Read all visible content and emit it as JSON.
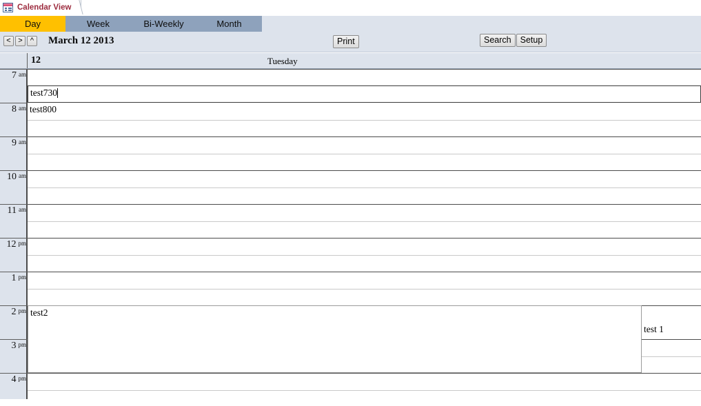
{
  "window": {
    "doc_tab": {
      "label": "Calendar View",
      "icon": "form-datasheet-icon"
    }
  },
  "view_tabs": [
    {
      "label": "Day",
      "active": true
    },
    {
      "label": "Week",
      "active": false
    },
    {
      "label": "Bi-Weekly",
      "active": false
    },
    {
      "label": "Month",
      "active": false
    }
  ],
  "toolbar": {
    "search_label": "Search",
    "setup_label": "Setup",
    "print_label": "Print",
    "prev_label": "<",
    "next_label": ">",
    "up_label": "^",
    "active_tab_color": "#ffc000",
    "tabbar_color": "#8ea2bc",
    "toolbar_color": "#dde3ec"
  },
  "date_nav": {
    "title": "March 12 2013"
  },
  "day_header": {
    "day_number": "12",
    "day_name": "Tuesday"
  },
  "hours": [
    {
      "hour": "7",
      "meridiem": "am"
    },
    {
      "hour": "8",
      "meridiem": "am"
    },
    {
      "hour": "9",
      "meridiem": "am"
    },
    {
      "hour": "10",
      "meridiem": "am"
    },
    {
      "hour": "11",
      "meridiem": "am"
    },
    {
      "hour": "12",
      "meridiem": "pm"
    },
    {
      "hour": "1",
      "meridiem": "pm"
    },
    {
      "hour": "2",
      "meridiem": "pm"
    },
    {
      "hour": "3",
      "meridiem": "pm"
    },
    {
      "hour": "4",
      "meridiem": "pm"
    }
  ],
  "appointments": [
    {
      "id": "appt-test730",
      "text": "test730",
      "focused": true,
      "caret": true,
      "time": "7:30 am"
    },
    {
      "id": "appt-test800",
      "text": "test800",
      "focused": false,
      "caret": false,
      "time": "8:00 am"
    },
    {
      "id": "appt-test2",
      "text": "test2",
      "focused": false,
      "caret": false,
      "time": "2:00 pm"
    },
    {
      "id": "appt-test1",
      "text": "test 1",
      "focused": false,
      "caret": false,
      "time": "2:30 pm"
    }
  ]
}
